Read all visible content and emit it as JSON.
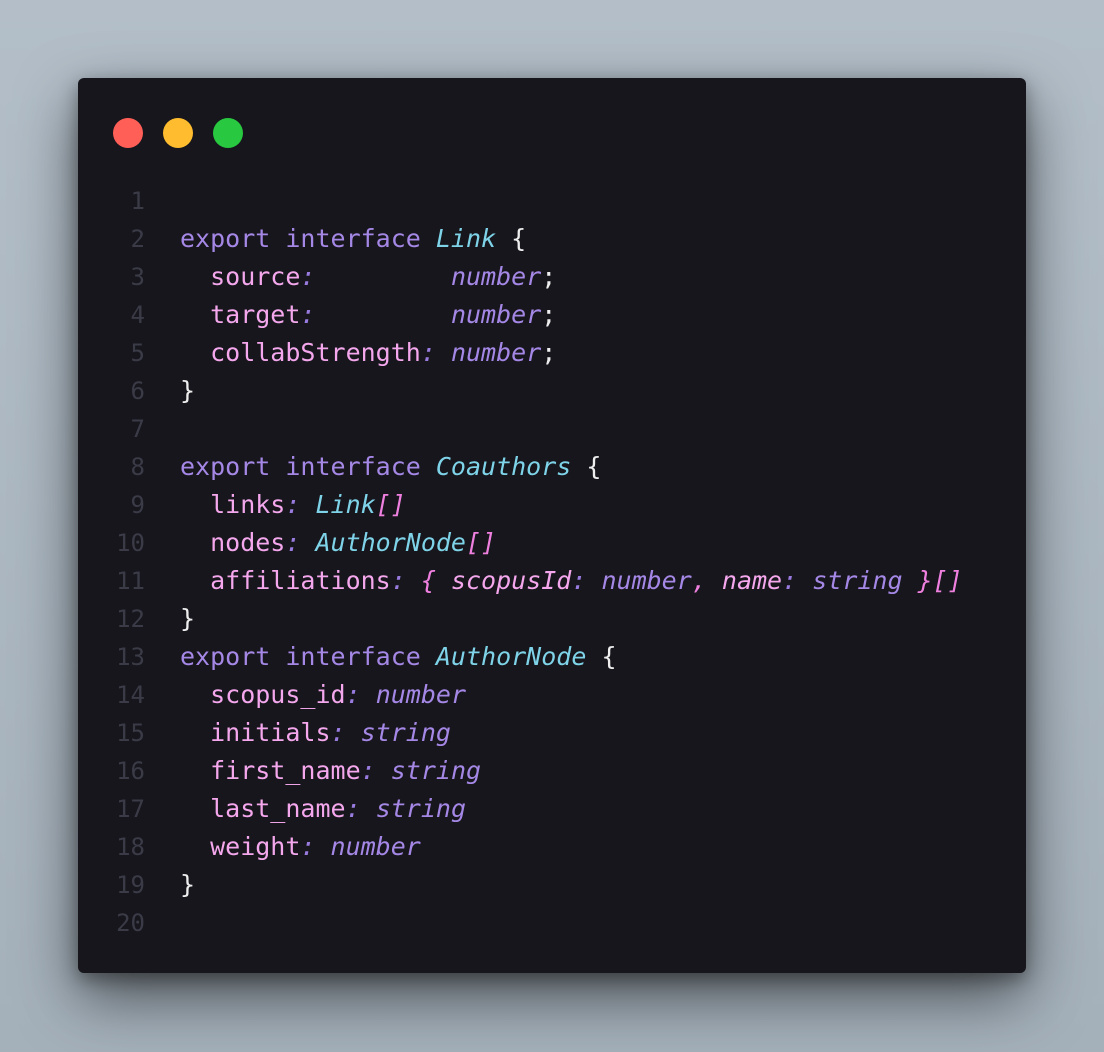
{
  "window": {
    "buttons": [
      {
        "name": "close",
        "color": "#ff5f57"
      },
      {
        "name": "minimize",
        "color": "#febc2e"
      },
      {
        "name": "maximize",
        "color": "#28c840"
      }
    ]
  },
  "code": {
    "lines": [
      {
        "n": "1",
        "tokens": []
      },
      {
        "n": "2",
        "tokens": [
          {
            "t": "export interface ",
            "c": "kw"
          },
          {
            "t": "Link",
            "c": "type"
          },
          {
            "t": " {",
            "c": "punct"
          }
        ]
      },
      {
        "n": "3",
        "tokens": [
          {
            "t": "  source",
            "c": "prop"
          },
          {
            "t": ":         ",
            "c": "colon"
          },
          {
            "t": "number",
            "c": "prim"
          },
          {
            "t": ";",
            "c": "punct"
          }
        ]
      },
      {
        "n": "4",
        "tokens": [
          {
            "t": "  target",
            "c": "prop"
          },
          {
            "t": ":         ",
            "c": "colon"
          },
          {
            "t": "number",
            "c": "prim"
          },
          {
            "t": ";",
            "c": "punct"
          }
        ]
      },
      {
        "n": "5",
        "tokens": [
          {
            "t": "  collabStrength",
            "c": "prop"
          },
          {
            "t": ": ",
            "c": "colon"
          },
          {
            "t": "number",
            "c": "prim"
          },
          {
            "t": ";",
            "c": "punct"
          }
        ]
      },
      {
        "n": "6",
        "tokens": [
          {
            "t": "}",
            "c": "punct"
          }
        ]
      },
      {
        "n": "7",
        "tokens": []
      },
      {
        "n": "8",
        "tokens": [
          {
            "t": "export interface ",
            "c": "kw"
          },
          {
            "t": "Coauthors",
            "c": "type"
          },
          {
            "t": " {",
            "c": "punct"
          }
        ]
      },
      {
        "n": "9",
        "tokens": [
          {
            "t": "  links",
            "c": "prop"
          },
          {
            "t": ": ",
            "c": "colon"
          },
          {
            "t": "Link",
            "c": "type"
          },
          {
            "t": "[]",
            "c": "typepunct"
          }
        ]
      },
      {
        "n": "10",
        "tokens": [
          {
            "t": "  nodes",
            "c": "prop"
          },
          {
            "t": ": ",
            "c": "colon"
          },
          {
            "t": "AuthorNode",
            "c": "type"
          },
          {
            "t": "[]",
            "c": "typepunct"
          }
        ]
      },
      {
        "n": "11",
        "tokens": [
          {
            "t": "  affiliations",
            "c": "prop"
          },
          {
            "t": ": ",
            "c": "colon"
          },
          {
            "t": "{ ",
            "c": "typepunct"
          },
          {
            "t": "scopusId",
            "c": "ptype"
          },
          {
            "t": ": ",
            "c": "colon"
          },
          {
            "t": "number",
            "c": "prim"
          },
          {
            "t": ", ",
            "c": "typepunct"
          },
          {
            "t": "name",
            "c": "ptype"
          },
          {
            "t": ": ",
            "c": "colon"
          },
          {
            "t": "string",
            "c": "prim"
          },
          {
            "t": " }[]",
            "c": "typepunct"
          }
        ]
      },
      {
        "n": "12",
        "tokens": [
          {
            "t": "}",
            "c": "punct"
          }
        ]
      },
      {
        "n": "13",
        "tokens": [
          {
            "t": "export interface ",
            "c": "kw"
          },
          {
            "t": "AuthorNode",
            "c": "type"
          },
          {
            "t": " {",
            "c": "punct"
          }
        ]
      },
      {
        "n": "14",
        "tokens": [
          {
            "t": "  scopus_id",
            "c": "prop"
          },
          {
            "t": ": ",
            "c": "colon"
          },
          {
            "t": "number",
            "c": "prim"
          }
        ]
      },
      {
        "n": "15",
        "tokens": [
          {
            "t": "  initials",
            "c": "prop"
          },
          {
            "t": ": ",
            "c": "colon"
          },
          {
            "t": "string",
            "c": "prim"
          }
        ]
      },
      {
        "n": "16",
        "tokens": [
          {
            "t": "  first_name",
            "c": "prop"
          },
          {
            "t": ": ",
            "c": "colon"
          },
          {
            "t": "string",
            "c": "prim"
          }
        ]
      },
      {
        "n": "17",
        "tokens": [
          {
            "t": "  last_name",
            "c": "prop"
          },
          {
            "t": ": ",
            "c": "colon"
          },
          {
            "t": "string",
            "c": "prim"
          }
        ]
      },
      {
        "n": "18",
        "tokens": [
          {
            "t": "  weight",
            "c": "prop"
          },
          {
            "t": ": ",
            "c": "colon"
          },
          {
            "t": "number",
            "c": "prim"
          }
        ]
      },
      {
        "n": "19",
        "tokens": [
          {
            "t": "}",
            "c": "punct"
          }
        ]
      },
      {
        "n": "20",
        "tokens": []
      }
    ]
  }
}
